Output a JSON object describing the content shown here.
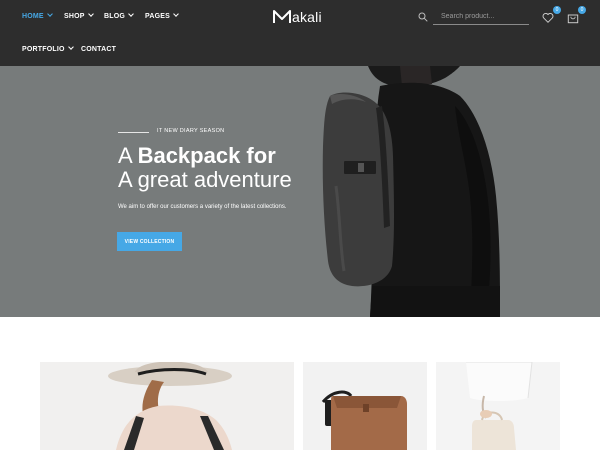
{
  "header": {
    "nav_items": [
      {
        "label": "HOME",
        "has_dropdown": true,
        "active": true
      },
      {
        "label": "SHOP",
        "has_dropdown": true,
        "active": false
      },
      {
        "label": "BLOG",
        "has_dropdown": true,
        "active": false
      },
      {
        "label": "PAGES",
        "has_dropdown": true,
        "active": false
      },
      {
        "label": "PORTFOLIO",
        "has_dropdown": true,
        "active": false
      },
      {
        "label": "CONTACT",
        "has_dropdown": false,
        "active": false
      }
    ],
    "logo_text": "akali",
    "logo_icon": "m-logo-icon",
    "search": {
      "placeholder": "Search product..."
    },
    "wishlist": {
      "icon": "heart-icon",
      "count": "0"
    },
    "cart": {
      "icon": "cart-icon",
      "count": "0"
    },
    "accent_color": "#46a8e6",
    "background_color": "#2d2d2d"
  },
  "hero": {
    "eyebrow": "IT NEW DIARY SEASON",
    "title_line1_light": "A ",
    "title_line1_bold": "Backpack for",
    "title_line2": "A great adventure",
    "description": "We aim to offer our customers a variety of the latest collections.",
    "button_label": "VIEW COLLECTION",
    "background_color": "#777b7b"
  },
  "products": [
    {
      "name": "woman-hat-backpack-tile"
    },
    {
      "name": "brown-bag-tile"
    },
    {
      "name": "white-handbag-tile"
    }
  ]
}
